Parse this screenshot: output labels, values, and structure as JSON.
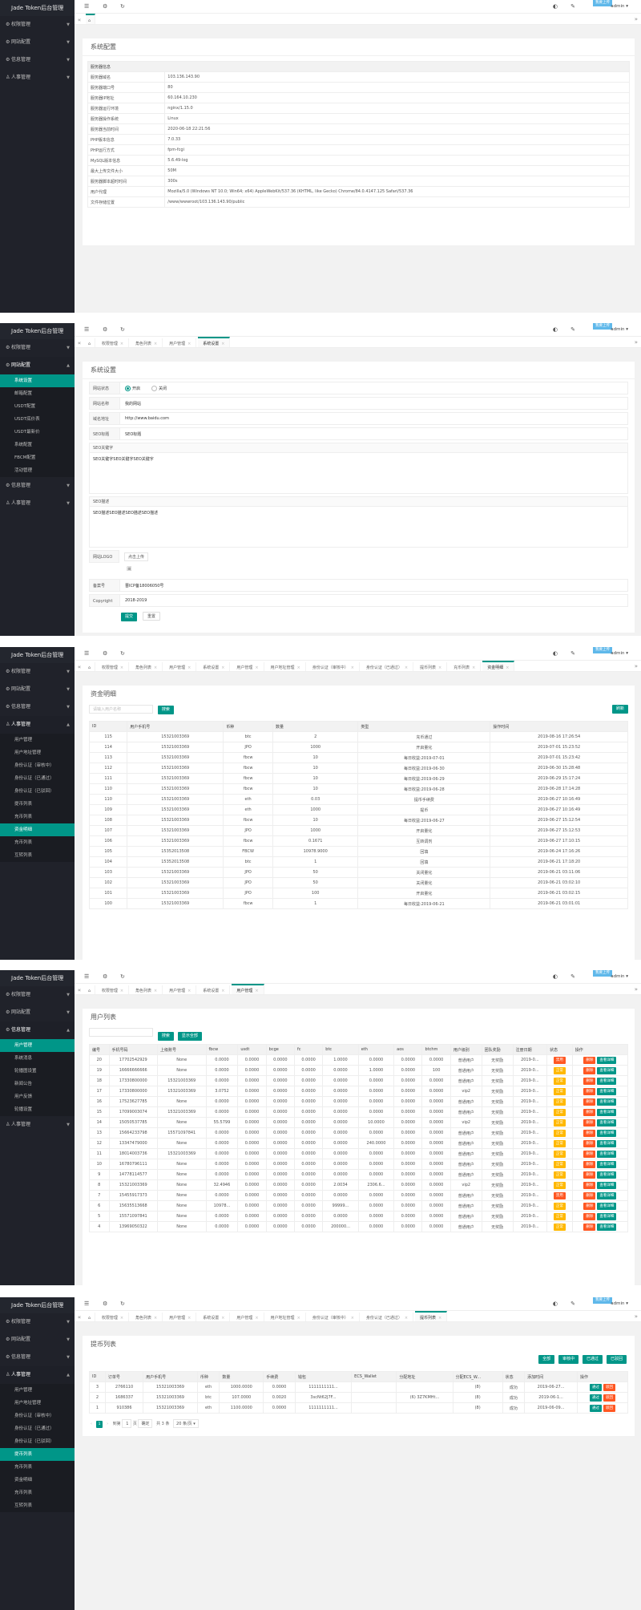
{
  "app_title": "Jade Token后台管理",
  "badge": "我要上传",
  "user": "admin",
  "menu": {
    "perm": "权限管理",
    "site": "网站配置",
    "info": "信息管理",
    "people": "人事管理"
  },
  "site_sub": [
    "系统设置",
    "邮箱配置",
    "USDT配置",
    "USDT底价表",
    "USDT最新价",
    "系统配置",
    "FBCM配置",
    "活动管理"
  ],
  "people_sub": [
    "用户管理",
    "用户地址管理",
    "身份认证（审核中）",
    "身份认证（已通过）",
    "身份认证（已驳回）",
    "提币列表",
    "充币列表",
    "资金明细",
    "充币列表",
    "互转列表"
  ],
  "people_sub2": [
    "用户管理",
    "用户地址管理",
    "身份认证（审核中）",
    "身份认证（已通过）",
    "身份认证（已驳回）",
    "提币列表",
    "充币列表",
    "资金明细",
    "充币列表",
    "互转列表"
  ],
  "info_sub": [
    "用户管理",
    "系统消息",
    "轮播图设置",
    "新闻公告",
    "用户反馈",
    "轮播设置"
  ],
  "tabs": {
    "tab1": "权限管理",
    "tab2": "角色列表",
    "tab3": "用户管理",
    "tab4": "系统设置",
    "tab5": "用户地址管理",
    "tab6": "身份认证（审核中）",
    "tab7": "身份认证（已通过）",
    "tab8": "提币列表",
    "tab9": "充币列表",
    "tab10": "资金明细"
  },
  "s1": {
    "title": "系统配置",
    "head": "服务器信息",
    "rows": [
      [
        "服务器域名",
        "103.136.143.90"
      ],
      [
        "服务器端口号",
        "80"
      ],
      [
        "服务器IP地址",
        "60.164.10.230"
      ],
      [
        "服务器运行环境",
        "nginx/1.15.0"
      ],
      [
        "服务器操作系统",
        "Linux"
      ],
      [
        "服务器当前时间",
        "2020-06-18 22:21:56"
      ],
      [
        "PHP版本信息",
        "7.0.33"
      ],
      [
        "PHP运行方式",
        "fpm-fcgi"
      ],
      [
        "MySQL版本信息",
        "5.6.49-log"
      ],
      [
        "最大上传文件大小",
        "50M"
      ],
      [
        "服务器脚本超时时间",
        "300s"
      ],
      [
        "用户代理",
        "Mozilla/5.0 (Windows NT 10.0; Win64; x64) AppleWebKit/537.36 (KHTML, like Gecko) Chrome/84.0.4147.125 Safari/537.36"
      ],
      [
        "文件存储位置",
        "/www/wwwroot/103.136.143.90/public"
      ]
    ]
  },
  "s2": {
    "title": "系统设置",
    "f_status": "网站状态",
    "on": "开启",
    "off": "关闭",
    "f_name": "网站名称",
    "v_name": "我的网站",
    "f_url": "域名地址",
    "v_url": "http://www.baidu.com",
    "f_seo": "SEO标题",
    "v_seo": "SEO标题",
    "f_kw": "SEO关键字",
    "v_kw": "SEO关键字SEO关键字SEO关键字",
    "f_desc": "SEO描述",
    "v_desc": "SEO描述SEO描述SEO描述SEO描述",
    "f_logo": "网站LOGO",
    "v_logo": "点击上传",
    "f_icp": "备案号",
    "v_icp": "晋ICP备18006050号",
    "f_copy": "Copyright",
    "v_copy": "2018-2019",
    "submit": "提交",
    "reset": "重置"
  },
  "s3": {
    "title": "资金明细",
    "ph": "请输入用户名称",
    "search": "搜索",
    "refresh": "刷新",
    "cols": [
      "ID",
      "用户手机号",
      "币种",
      "数量",
      "类型",
      "操作时间"
    ],
    "rows": [
      [
        "115",
        "15321003369",
        "btc",
        "2",
        "充币通过",
        "2019-08-16 17:26:54"
      ],
      [
        "114",
        "15321003369",
        "JPO",
        "1000",
        "开启量化",
        "2019-07-01 15:23:52"
      ],
      [
        "113",
        "15321003369",
        "fbcw",
        "10",
        "每日收益:2019-07-01",
        "2019-07-01 15:23:42"
      ],
      [
        "112",
        "15321003369",
        "fbcw",
        "10",
        "每日收益:2019-06-30",
        "2019-06-30 15:28:48"
      ],
      [
        "111",
        "15321003369",
        "fbcw",
        "10",
        "每日收益:2019-06-29",
        "2019-06-29 15:17:24"
      ],
      [
        "110",
        "15321003369",
        "fbcw",
        "10",
        "每日收益:2019-06-28",
        "2019-06-28 17:14:28"
      ],
      [
        "110",
        "15321003369",
        "eth",
        "0.03",
        "提币手续费",
        "2019-06-27 10:16:49"
      ],
      [
        "109",
        "15321003369",
        "eth",
        "1000",
        "提币",
        "2019-06-27 10:16:49"
      ],
      [
        "108",
        "15321003369",
        "fbcw",
        "10",
        "每日收益:2019-06-27",
        "2019-06-27 15:12:54"
      ],
      [
        "107",
        "15321003369",
        "JPO",
        "1000",
        "开启量化",
        "2019-06-27 15:12:53"
      ],
      [
        "106",
        "15321003369",
        "fbcw",
        "0.1671",
        "互转调剂",
        "2019-06-27 17:10:15"
      ],
      [
        "105",
        "15352013508",
        "FBCW",
        "10978.9000",
        "回填",
        "2019-06-24 17:16:26"
      ],
      [
        "104",
        "15352013508",
        "btc",
        "1",
        "回填",
        "2019-06-21 17:18:20"
      ],
      [
        "103",
        "15321003369",
        "JPO",
        "50",
        "关闭量化",
        "2019-06-21 03:11:06"
      ],
      [
        "102",
        "15321003369",
        "JPO",
        "50",
        "关闭量化",
        "2019-06-21 03:02:10"
      ],
      [
        "101",
        "15321003369",
        "JPO",
        "100",
        "开启量化",
        "2019-06-21 03:02:15"
      ],
      [
        "100",
        "15321003369",
        "fbcw",
        "1",
        "每日收益:2019-06-21",
        "2019-06-21 03:01:01"
      ]
    ]
  },
  "s4": {
    "title": "用户列表",
    "search": "搜索",
    "show_all": "显示全部",
    "cols": [
      "编号",
      "手机号码",
      "上级账号",
      "fbcw",
      "usdt",
      "bcge",
      "fc",
      "btc",
      "eth",
      "aos",
      "btchm",
      "用户级别",
      "团队奖励",
      "注册日期",
      "状态",
      "操作"
    ],
    "rows": [
      [
        "20",
        "17702542929",
        "None",
        "0.0000",
        "0.0000",
        "0.0000",
        "0.0000",
        "1.0000",
        "0.0000",
        "0.0000",
        "0.0000",
        "普通用户",
        "无奖励",
        "2019-0..."
      ],
      [
        "19",
        "16666666666",
        "None",
        "0.0000",
        "0.0000",
        "0.0000",
        "0.0000",
        "0.0000",
        "1.0000",
        "0.0000",
        "100",
        "普通用户",
        "无奖励",
        "2019-0..."
      ],
      [
        "18",
        "17330800000",
        "15321003369",
        "0.0000",
        "0.0000",
        "0.0000",
        "0.0000",
        "0.0000",
        "0.0000",
        "0.0000",
        "0.0000",
        "普通用户",
        "无奖励",
        "2019-0..."
      ],
      [
        "17",
        "17330800000",
        "15321003369",
        "3.0752",
        "0.0000",
        "0.0000",
        "0.0000",
        "0.0000",
        "0.0000",
        "0.0000",
        "0.0000",
        "vip2",
        "无奖励",
        "2019-0..."
      ],
      [
        "16",
        "17523627785",
        "None",
        "0.0000",
        "0.0000",
        "0.0000",
        "0.0000",
        "0.0000",
        "0.0000",
        "0.0000",
        "0.0000",
        "普通用户",
        "无奖励",
        "2019-0..."
      ],
      [
        "15",
        "17099003074",
        "15321003369",
        "0.0000",
        "0.0000",
        "0.0000",
        "0.0000",
        "0.0000",
        "0.0000",
        "0.0000",
        "0.0000",
        "普通用户",
        "无奖励",
        "2019-0..."
      ],
      [
        "14",
        "15050537785",
        "None",
        "55.5799",
        "0.0000",
        "0.0000",
        "0.0000",
        "0.0000",
        "10.0000",
        "0.0000",
        "0.0000",
        "vip2",
        "无奖励",
        "2019-0..."
      ],
      [
        "13",
        "15664233798",
        "15571097841",
        "0.0000",
        "0.0000",
        "0.0000",
        "0.0000",
        "0.0000",
        "0.0000",
        "0.0000",
        "0.0000",
        "普通用户",
        "无奖励",
        "2019-0..."
      ],
      [
        "12",
        "13347479000",
        "None",
        "0.0000",
        "0.0000",
        "0.0000",
        "0.0000",
        "0.0000",
        "240.0000",
        "0.0000",
        "0.0000",
        "普通用户",
        "无奖励",
        "2019-0..."
      ],
      [
        "11",
        "18014003736",
        "15321003369",
        "0.0000",
        "0.0000",
        "0.0000",
        "0.0000",
        "0.0000",
        "0.0000",
        "0.0000",
        "0.0000",
        "普通用户",
        "无奖励",
        "2019-0..."
      ],
      [
        "10",
        "16780796111",
        "None",
        "0.0000",
        "0.0000",
        "0.0000",
        "0.0000",
        "0.0000",
        "0.0000",
        "0.0000",
        "0.0000",
        "普通用户",
        "无奖励",
        "2019-0..."
      ],
      [
        "9",
        "14778114577",
        "None",
        "0.0000",
        "0.0000",
        "0.0000",
        "0.0000",
        "0.0000",
        "0.0000",
        "0.0000",
        "0.0000",
        "普通用户",
        "无奖励",
        "2019-0..."
      ],
      [
        "8",
        "15321003369",
        "None",
        "32.4946",
        "0.0000",
        "0.0000",
        "0.0000",
        "2.0034",
        "2306.6...",
        "0.0000",
        "0.0000",
        "vip2",
        "无奖励",
        "2019-0..."
      ],
      [
        "7",
        "15455917373",
        "None",
        "0.0000",
        "0.0000",
        "0.0000",
        "0.0000",
        "0.0000",
        "0.0000",
        "0.0000",
        "0.0000",
        "普通用户",
        "无奖励",
        "2019-0..."
      ],
      [
        "6",
        "15635513668",
        "None",
        "10978...",
        "0.0000",
        "0.0000",
        "0.0000",
        "99999...",
        "0.0000",
        "0.0000",
        "0.0000",
        "普通用户",
        "无奖励",
        "2019-0..."
      ],
      [
        "5",
        "15571097841",
        "None",
        "0.0000",
        "0.0000",
        "0.0000",
        "0.0000",
        "0.0000",
        "0.0000",
        "0.0000",
        "0.0000",
        "普通用户",
        "无奖励",
        "2019-0..."
      ],
      [
        "4",
        "13969050322",
        "None",
        "0.0000",
        "0.0000",
        "0.0000",
        "0.0000",
        "200000...",
        "0.0000",
        "0.0000",
        "0.0000",
        "普通用户",
        "无奖励",
        "2019-0..."
      ]
    ],
    "st_on": "正常",
    "st_off": "禁用",
    "op_del": "删除",
    "op_edit": "查看详细"
  },
  "s5": {
    "title": "提币列表",
    "b_all": "全部",
    "b_rev": "审核中",
    "b_pass": "已通过",
    "b_rej": "已驳回",
    "cols": [
      "ID",
      "订单号",
      "用户手机号",
      "币种",
      "数量",
      "手续费",
      "钱包",
      "ECS_Wallet",
      "分配地址",
      "分配ECS_W...",
      "状态",
      "添加时间",
      "操作"
    ],
    "rows": [
      [
        "3",
        "2766110",
        "15321003369",
        "eth",
        "1000.0000",
        "0.0000",
        "1111111111...",
        "",
        "",
        "(8)",
        "成功",
        "2019-06-27..."
      ],
      [
        "2",
        "1686337",
        "15321003369",
        "btc",
        "107.0000",
        "0.0020",
        "3scNt62J7F...",
        "",
        "(6) 3Z7KMHt...",
        "(8)",
        "成功",
        "2019-06-1..."
      ],
      [
        "1",
        "910386",
        "15321003369",
        "eth",
        "1100.0000",
        "0.0000",
        "1111111111...",
        "",
        "",
        "(8)",
        "成功",
        "2019-06-09..."
      ]
    ],
    "op_pass": "通过",
    "op_rej": "驳回",
    "page": "1",
    "goto": "到第",
    "page_unit": "页",
    "go": "确定",
    "total": "共 3 条",
    "per": "20 条/页"
  }
}
